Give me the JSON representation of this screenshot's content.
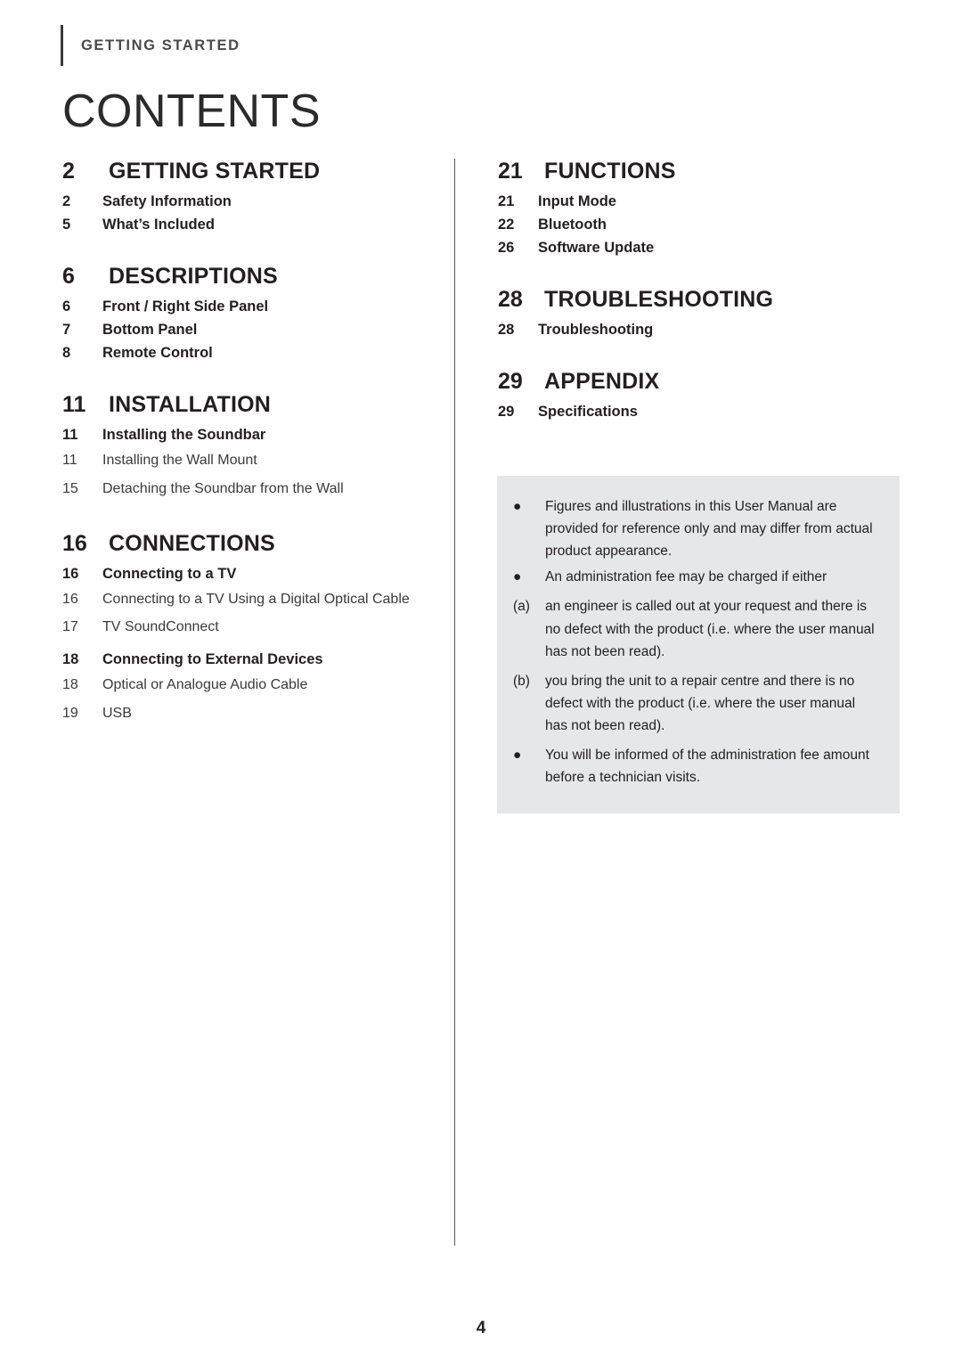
{
  "header": {
    "eyebrow": "GETTING STARTED",
    "title": "CONTENTS"
  },
  "left_column": [
    {
      "type": "section",
      "num": "2",
      "label": "GETTING STARTED",
      "children": [
        {
          "type": "sub",
          "num": "2",
          "label": "Safety Information"
        },
        {
          "type": "sub",
          "num": "5",
          "label": "What’s Included"
        }
      ]
    },
    {
      "type": "section",
      "num": "6",
      "label": "DESCRIPTIONS",
      "children": [
        {
          "type": "sub",
          "num": "6",
          "label": "Front / Right Side Panel"
        },
        {
          "type": "sub",
          "num": "7",
          "label": "Bottom Panel"
        },
        {
          "type": "sub",
          "num": "8",
          "label": "Remote Control"
        }
      ]
    },
    {
      "type": "section",
      "num": "11",
      "label": "INSTALLATION",
      "children": [
        {
          "type": "sub",
          "num": "11",
          "label": "Installing the Soundbar"
        },
        {
          "type": "item",
          "num": "11",
          "label": "Installing the Wall Mount"
        },
        {
          "type": "item",
          "num": "15",
          "label": "Detaching the Soundbar from the Wall"
        }
      ]
    },
    {
      "type": "section",
      "num": "16",
      "label": "CONNECTIONS",
      "children": [
        {
          "type": "sub",
          "num": "16",
          "label": "Connecting to a TV"
        },
        {
          "type": "item",
          "num": "16",
          "label": "Connecting to a TV Using a Digital Optical Cable"
        },
        {
          "type": "item",
          "num": "17",
          "label": "TV SoundConnect"
        },
        {
          "type": "sub",
          "num": "18",
          "label": "Connecting to External Devices"
        },
        {
          "type": "item",
          "num": "18",
          "label": "Optical or Analogue Audio Cable"
        },
        {
          "type": "item",
          "num": "19",
          "label": "USB"
        }
      ]
    }
  ],
  "right_column": [
    {
      "type": "section",
      "num": "21",
      "label": "FUNCTIONS",
      "children": [
        {
          "type": "sub",
          "num": "21",
          "label": "Input Mode"
        },
        {
          "type": "sub",
          "num": "22",
          "label": "Bluetooth"
        },
        {
          "type": "sub",
          "num": "26",
          "label": "Software Update"
        }
      ]
    },
    {
      "type": "section",
      "num": "28",
      "label": "TROUBLESHOOTING",
      "children": [
        {
          "type": "sub",
          "num": "28",
          "label": "Troubleshooting"
        }
      ]
    },
    {
      "type": "section",
      "num": "29",
      "label": "APPENDIX",
      "children": [
        {
          "type": "sub",
          "num": "29",
          "label": "Specifications"
        }
      ]
    }
  ],
  "note_box": {
    "background_color": "#e6e7e8",
    "lines": [
      {
        "marker": "●",
        "text": "Figures and illustrations in this User Manual are provided for reference only and may differ from actual product appearance."
      },
      {
        "marker": "●",
        "text": "An administration fee may be charged if either"
      },
      {
        "marker": "(a)",
        "text": "an engineer is called out at your request and there is no defect with the product (i.e. where the user manual has not been read)."
      },
      {
        "marker": "(b)",
        "text": "you bring the unit to a repair centre and there is no defect with the product (i.e. where the user manual has not been read)."
      },
      {
        "marker": "●",
        "text": "You will be informed of the administration fee amount before a technician visits."
      }
    ]
  },
  "footer": {
    "page_number": "4"
  }
}
